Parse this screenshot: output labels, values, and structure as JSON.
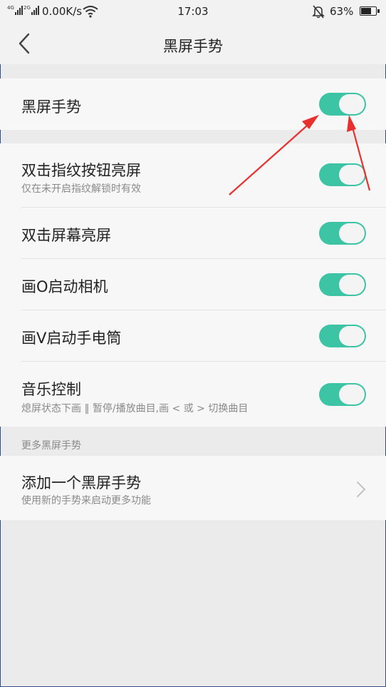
{
  "status_bar": {
    "net1": "4G",
    "net2": "2G",
    "speed": "0.00K/s",
    "time": "17:03",
    "battery_text": "63%",
    "battery_level": 0.63,
    "icons": [
      "signal-icon",
      "wifi-icon",
      "mute-icon",
      "battery-icon"
    ]
  },
  "header": {
    "title": "黑屏手势",
    "back_icon": "back-arrow-icon"
  },
  "main_switch": {
    "label": "黑屏手势",
    "on": true
  },
  "gestures": [
    {
      "label": "双击指纹按钮亮屏",
      "sub": "仅在未开启指纹解锁时有效",
      "on": true
    },
    {
      "label": "双击屏幕亮屏",
      "sub": "",
      "on": true
    },
    {
      "label": "画O启动相机",
      "sub": "",
      "on": true
    },
    {
      "label": "画V启动手电筒",
      "sub": "",
      "on": true
    },
    {
      "label": "音乐控制",
      "sub": "熄屏状态下画 ‖ 暂停/播放曲目,画 < 或 > 切换曲目",
      "on": true
    }
  ],
  "more_section": {
    "label": "更多黑屏手势",
    "item_label": "添加一个黑屏手势",
    "item_sub": "使用新的手势来启动更多功能",
    "chevron_icon": "chevron-right-icon"
  },
  "colors": {
    "accent": "#3cc4a5",
    "annotation": "#e8302f",
    "background": "#ebebeb",
    "card": "#f7f7f7"
  }
}
